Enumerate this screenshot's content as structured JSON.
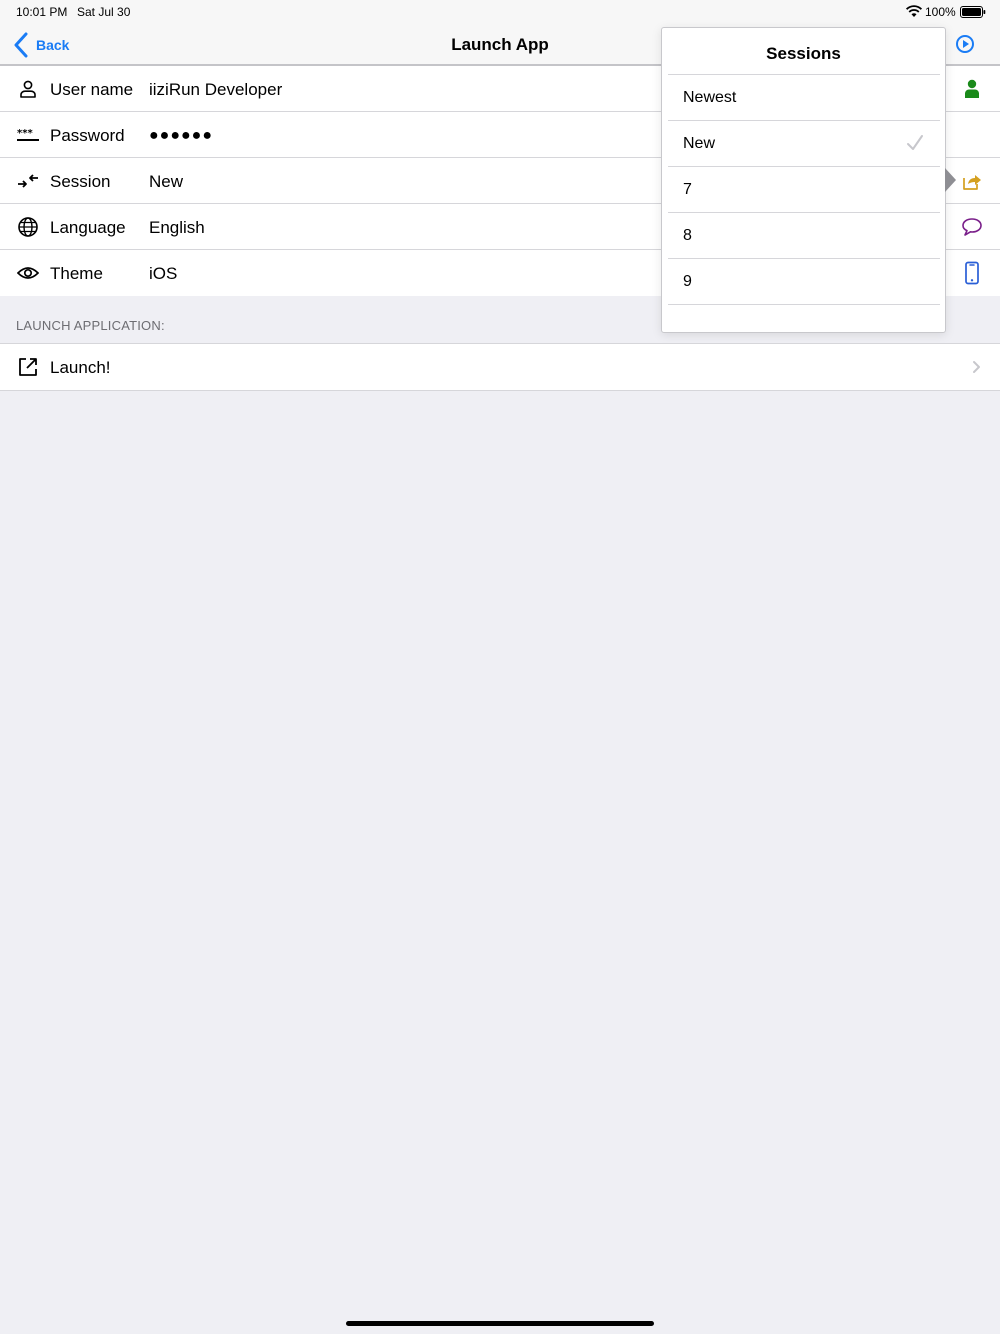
{
  "status": {
    "time": "10:01 PM",
    "date": "Sat Jul 30",
    "battery": "100%"
  },
  "nav": {
    "back_label": "Back",
    "title": "Launch App"
  },
  "settings": [
    {
      "label": "User name",
      "value": "iiziRun Developer",
      "icon": "person-icon",
      "accessory": "person-filled-icon",
      "accent": "#1a8a1a"
    },
    {
      "label": "Password",
      "value": "●●●●●●",
      "icon": "password-dots-icon",
      "accessory": "",
      "accent": ""
    },
    {
      "label": "Session",
      "value": "New",
      "icon": "swap-arrows-icon",
      "accessory": "share-icon",
      "accent": "#d4a020"
    },
    {
      "label": "Language",
      "value": "English",
      "icon": "globe-icon",
      "accessory": "speech-bubble-icon",
      "accent": "#7a1f8a"
    },
    {
      "label": "Theme",
      "value": "iOS",
      "icon": "eye-icon",
      "accessory": "phone-icon",
      "accent": "#2a5fd6"
    }
  ],
  "section_launch": {
    "header": "LAUNCH APPLICATION:",
    "item_label": "Launch!"
  },
  "popover": {
    "title": "Sessions",
    "items": [
      "Newest",
      "New",
      "7",
      "8",
      "9"
    ],
    "selected": "New"
  },
  "colors": {
    "tint": "#1a7cf5",
    "background": "#efeff4"
  }
}
